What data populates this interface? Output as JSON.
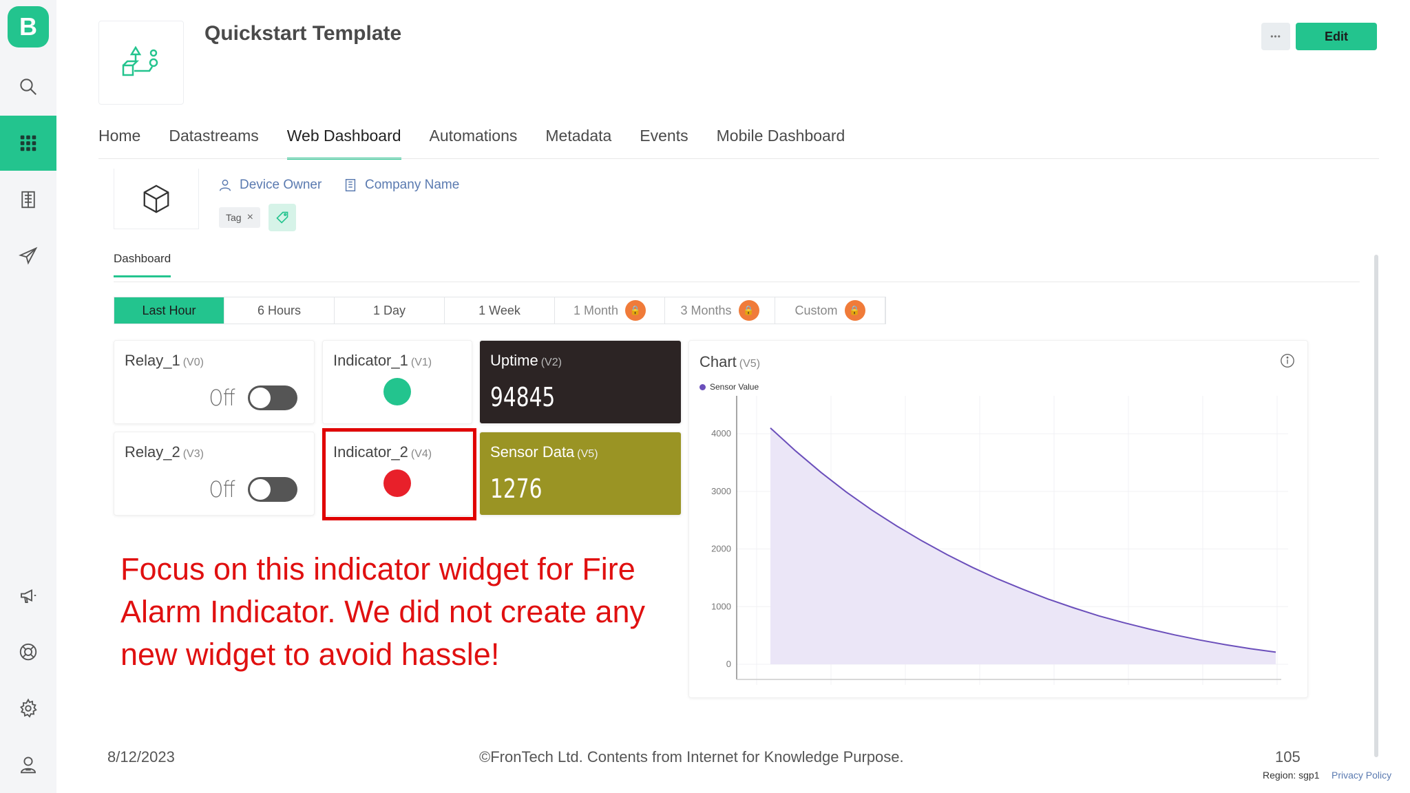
{
  "app": {
    "logo_letter": "B",
    "title": "Quickstart Template"
  },
  "header": {
    "more_label": "•••",
    "edit_label": "Edit"
  },
  "sidebar": {
    "items": [
      "search-icon",
      "grid-icon",
      "building-icon",
      "send-icon",
      "megaphone-icon",
      "lifebuoy-icon",
      "gear-icon",
      "user-icon"
    ],
    "active": "grid-icon"
  },
  "tabs": [
    "Home",
    "Datastreams",
    "Web Dashboard",
    "Automations",
    "Metadata",
    "Events",
    "Mobile Dashboard"
  ],
  "active_tab": "Web Dashboard",
  "device": {
    "owner": "Device Owner",
    "company": "Company Name",
    "tag": "Tag"
  },
  "dashboard_label": "Dashboard",
  "ranges": [
    {
      "label": "Last Hour",
      "active": true,
      "locked": false
    },
    {
      "label": "6 Hours",
      "active": false,
      "locked": false
    },
    {
      "label": "1 Day",
      "active": false,
      "locked": false
    },
    {
      "label": "1 Week",
      "active": false,
      "locked": false
    },
    {
      "label": "1 Month",
      "active": false,
      "locked": true
    },
    {
      "label": "3 Months",
      "active": false,
      "locked": true
    },
    {
      "label": "Custom",
      "active": false,
      "locked": true
    }
  ],
  "widgets": {
    "relay1": {
      "title": "Relay_1",
      "pin": "(V0)",
      "state": "Off"
    },
    "relay2": {
      "title": "Relay_2",
      "pin": "(V3)",
      "state": "Off"
    },
    "indicator1": {
      "title": "Indicator_1",
      "pin": "(V1)",
      "color": "#23c48e"
    },
    "indicator2": {
      "title": "Indicator_2",
      "pin": "(V4)",
      "color": "#e8202a"
    },
    "uptime": {
      "title": "Uptime",
      "pin": "(V2)",
      "value": "94845",
      "bg": "#2c2424"
    },
    "sensor": {
      "title": "Sensor Data",
      "pin": "(V5)",
      "value": "1276",
      "bg": "#9a9424"
    },
    "chart": {
      "title": "Chart",
      "pin": "(V5)",
      "legend": "Sensor Value"
    }
  },
  "annotation": "Focus on this indicator widget for Fire Alarm Indicator. We did not create any new widget to avoid hassle!",
  "chart_data": {
    "type": "area",
    "title": "Chart",
    "series": [
      {
        "name": "Sensor Value",
        "color": "#6b4fbb",
        "x": [
          0,
          0.05,
          0.1,
          0.15,
          0.2,
          0.25,
          0.3,
          0.35,
          0.4,
          0.45,
          0.5,
          0.55,
          0.6,
          0.65,
          0.7,
          0.75,
          0.8,
          0.85,
          0.9,
          0.95,
          1.0
        ],
        "values": [
          4100,
          3700,
          3330,
          2990,
          2680,
          2400,
          2140,
          1900,
          1680,
          1480,
          1300,
          1130,
          980,
          840,
          720,
          610,
          510,
          420,
          340,
          270,
          210
        ]
      }
    ],
    "y_ticks": [
      "0",
      "1000",
      "2000",
      "3000",
      "4000"
    ],
    "ylim": [
      0,
      4300
    ]
  },
  "footer": {
    "date": "8/12/2023",
    "copyright": "©FronTech Ltd. Contents from Internet for Knowledge Purpose.",
    "page": "105",
    "region": "Region: sgp1",
    "privacy": "Privacy Policy"
  }
}
